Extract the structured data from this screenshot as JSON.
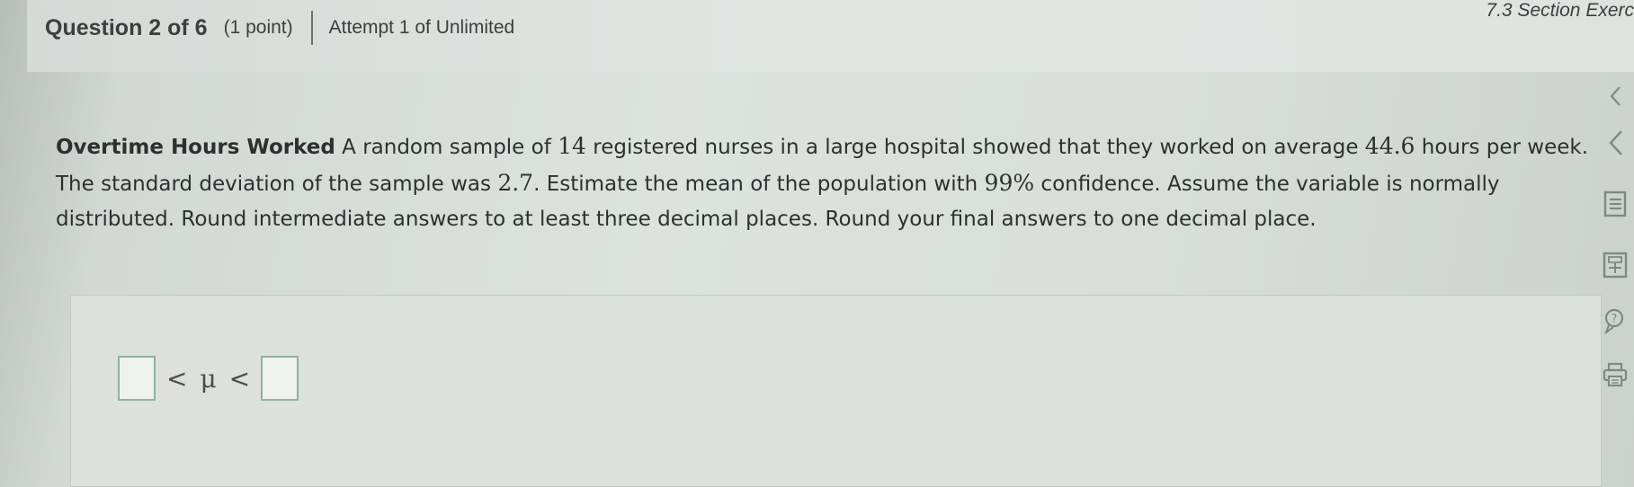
{
  "header": {
    "question_number": "Question 2 of 6",
    "points": "(1 point)",
    "attempt": "Attempt 1 of Unlimited",
    "section_title": "7.3 Section Exerc"
  },
  "question": {
    "topic": "Overtime Hours Worked",
    "part1": " A random sample of ",
    "sample_size": "14",
    "part2": " registered nurses in a large hospital showed that they worked on average ",
    "mean": "44.6",
    "part3": " hours per week. The standard deviation of the sample was ",
    "std_dev": "2.7",
    "part4": ". Estimate the mean of the population with ",
    "confidence": "99%",
    "part5": " confidence. Assume the variable is normally distributed. Round intermediate answers to at least three decimal places. Round your final answers to one decimal place."
  },
  "answer": {
    "less_than_left": "<",
    "mu_symbol": "μ",
    "less_than_right": "<",
    "lower_value": "",
    "upper_value": ""
  },
  "toolbar": {
    "icons": [
      "chevron-left-icon",
      "chevron-left-icon",
      "list-icon",
      "calculator-icon",
      "help-icon",
      "print-icon"
    ]
  },
  "colors": {
    "text": "#2d302f",
    "answer_box_border": "#8fb0a3",
    "accent_icon": "#6c7b74"
  }
}
